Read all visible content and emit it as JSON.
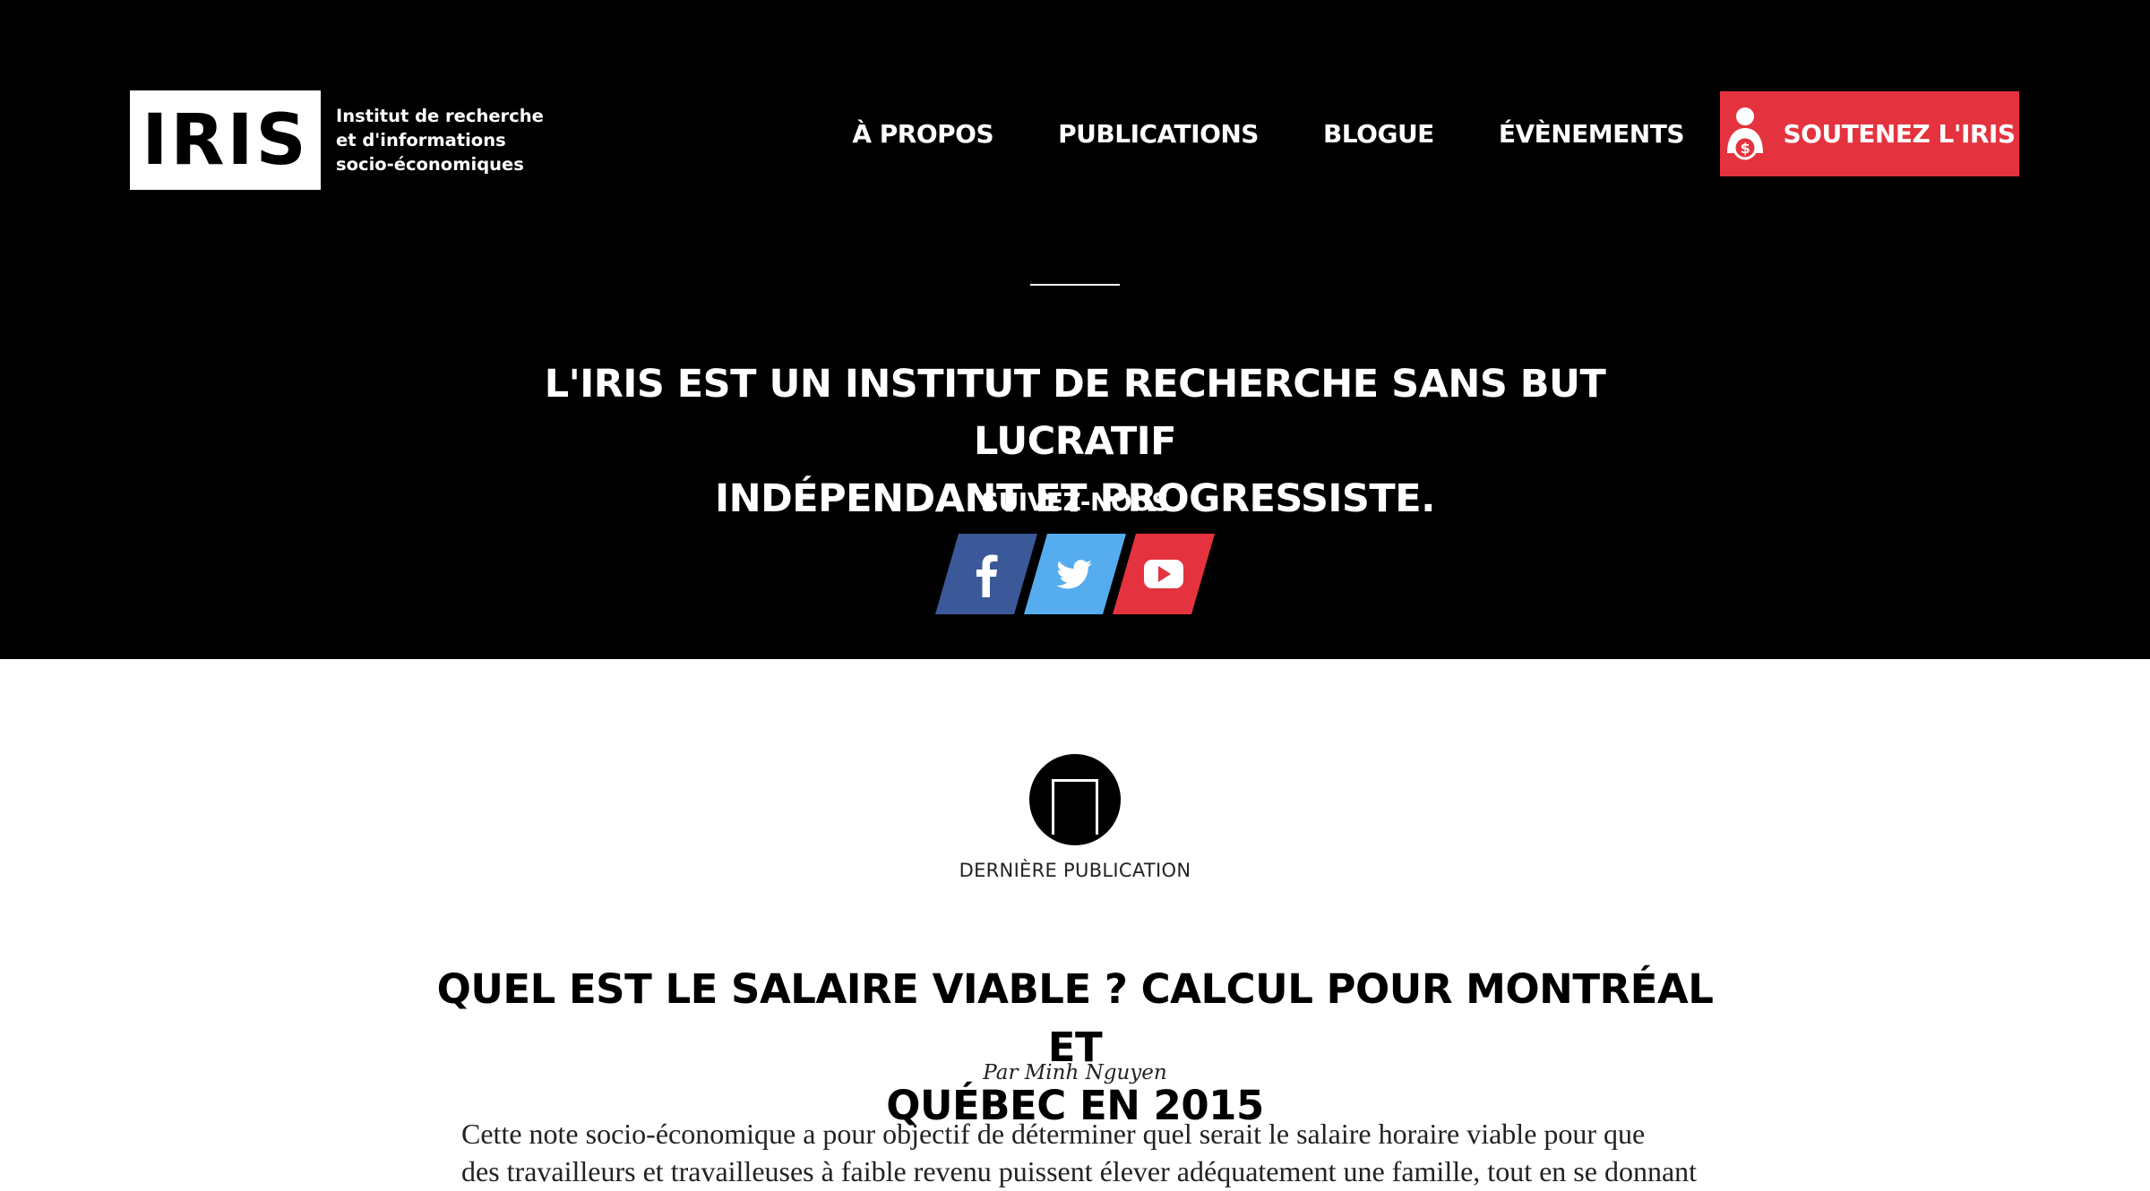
{
  "logo": {
    "mark": "IRIS",
    "subtitle_lines": [
      "Institut de recherche",
      "et d'informations",
      "socio-économiques"
    ]
  },
  "nav": {
    "items": [
      "À PROPOS",
      "PUBLICATIONS",
      "BLOGUE",
      "ÉVÈNEMENTS"
    ],
    "donate_label": "SOUTENEZ L'IRIS",
    "donate_icon": "person-with-coin-icon"
  },
  "hero": {
    "tagline_lines": [
      "L'IRIS EST UN INSTITUT DE RECHERCHE SANS BUT LUCRATIF",
      "INDÉPENDANT ET PROGRESSISTE."
    ],
    "follow_label": "SUIVEZ-NOUS",
    "social": [
      {
        "name": "facebook",
        "icon": "facebook-icon",
        "color": "#3b5998"
      },
      {
        "name": "twitter",
        "icon": "twitter-icon",
        "color": "#55acee"
      },
      {
        "name": "youtube",
        "icon": "youtube-icon",
        "color": "#e4333e"
      }
    ]
  },
  "publication": {
    "label": "DERNIÈRE PUBLICATION",
    "title_lines": [
      "QUEL EST LE SALAIRE VIABLE ? CALCUL POUR MONTRÉAL ET",
      "QUÉBEC EN 2015"
    ],
    "author": "Par Minh Nguyen",
    "excerpt_lines": [
      "Cette note socio-économique a pour objectif de déterminer quel serait le salaire horaire viable pour que",
      "des travailleurs et travailleuses à faible revenu puissent élever adéquatement une famille, tout en se donnant"
    ]
  },
  "colors": {
    "hero_bg": "#000000",
    "accent_red": "#e4333e",
    "facebook": "#3b5998",
    "twitter": "#55acee"
  }
}
